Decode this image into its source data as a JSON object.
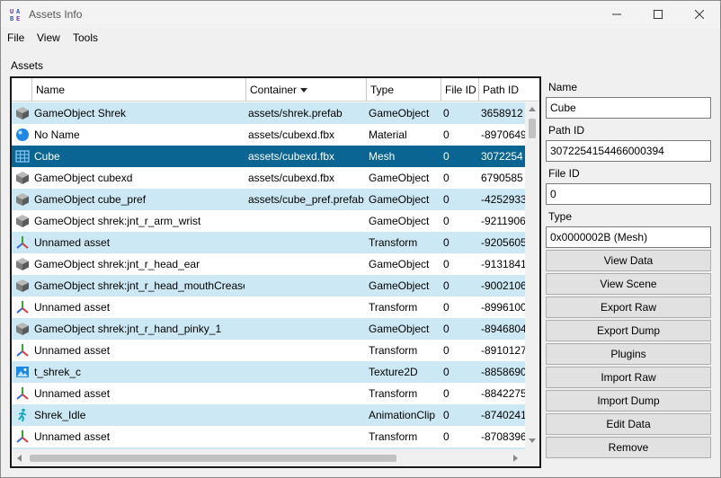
{
  "window": {
    "title": "Assets Info"
  },
  "menu": [
    "File",
    "View",
    "Tools"
  ],
  "section_label": "Assets",
  "table": {
    "columns": [
      "Name",
      "Container",
      "Type",
      "File ID",
      "Path ID"
    ],
    "sorted_column": "Container",
    "rows": [
      {
        "icon": "gameobject-icon",
        "name": "GameObject Shrek",
        "container": "assets/shrek.prefab",
        "type": "GameObject",
        "file_id": "0",
        "path_id": "3658912"
      },
      {
        "icon": "material-icon",
        "name": "No Name",
        "container": "assets/cubexd.fbx",
        "type": "Material",
        "file_id": "0",
        "path_id": "-8970649"
      },
      {
        "icon": "mesh-icon",
        "name": "Cube",
        "container": "assets/cubexd.fbx",
        "type": "Mesh",
        "file_id": "0",
        "path_id": "3072254",
        "selected": true
      },
      {
        "icon": "gameobject-icon",
        "name": "GameObject cubexd",
        "container": "assets/cubexd.fbx",
        "type": "GameObject",
        "file_id": "0",
        "path_id": "6790585"
      },
      {
        "icon": "gameobject-icon",
        "name": "GameObject cube_pref",
        "container": "assets/cube_pref.prefab",
        "type": "GameObject",
        "file_id": "0",
        "path_id": "-4252933"
      },
      {
        "icon": "gameobject-icon",
        "name": "GameObject shrek:jnt_r_arm_wrist",
        "container": "",
        "type": "GameObject",
        "file_id": "0",
        "path_id": "-9211906"
      },
      {
        "icon": "transform-icon",
        "name": "Unnamed asset",
        "container": "",
        "type": "Transform",
        "file_id": "0",
        "path_id": "-9205605"
      },
      {
        "icon": "gameobject-icon",
        "name": "GameObject shrek:jnt_r_head_ear",
        "container": "",
        "type": "GameObject",
        "file_id": "0",
        "path_id": "-9131841"
      },
      {
        "icon": "gameobject-icon",
        "name": "GameObject shrek:jnt_r_head_mouthCrease",
        "container": "",
        "type": "GameObject",
        "file_id": "0",
        "path_id": "-9002106"
      },
      {
        "icon": "transform-icon",
        "name": "Unnamed asset",
        "container": "",
        "type": "Transform",
        "file_id": "0",
        "path_id": "-8996100"
      },
      {
        "icon": "gameobject-icon",
        "name": "GameObject shrek:jnt_r_hand_pinky_1",
        "container": "",
        "type": "GameObject",
        "file_id": "0",
        "path_id": "-8946804"
      },
      {
        "icon": "transform-icon",
        "name": "Unnamed asset",
        "container": "",
        "type": "Transform",
        "file_id": "0",
        "path_id": "-8910127"
      },
      {
        "icon": "texture-icon",
        "name": "t_shrek_c",
        "container": "",
        "type": "Texture2D",
        "file_id": "0",
        "path_id": "-8858690"
      },
      {
        "icon": "transform-icon",
        "name": "Unnamed asset",
        "container": "",
        "type": "Transform",
        "file_id": "0",
        "path_id": "-8842275"
      },
      {
        "icon": "animation-icon",
        "name": "Shrek_Idle",
        "container": "",
        "type": "AnimationClip",
        "file_id": "0",
        "path_id": "-8740241"
      },
      {
        "icon": "transform-icon",
        "name": "Unnamed asset",
        "container": "",
        "type": "Transform",
        "file_id": "0",
        "path_id": "-8708396"
      },
      {
        "icon": "transform-icon",
        "name": "",
        "container": "",
        "type": "",
        "file_id": "",
        "path_id": ""
      }
    ]
  },
  "details": {
    "name_label": "Name",
    "name_value": "Cube",
    "path_id_label": "Path ID",
    "path_id_value": "3072254154466000394",
    "file_id_label": "File ID",
    "file_id_value": "0",
    "type_label": "Type",
    "type_value": "0x0000002B (Mesh)"
  },
  "buttons": [
    "View Data",
    "View Scene",
    "Export Raw",
    "Export Dump",
    "Plugins",
    "Import Raw",
    "Import Dump",
    "Edit Data",
    "Remove"
  ],
  "colors": {
    "selection": "#0a6592",
    "alt_row": "#cde8f5"
  }
}
